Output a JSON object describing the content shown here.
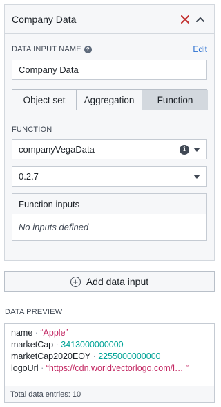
{
  "panel": {
    "title": "Company Data",
    "colors": {
      "close": "#c23030",
      "link": "#2d72d2"
    }
  },
  "data_input": {
    "label": "DATA INPUT NAME",
    "edit": "Edit",
    "value": "Company Data"
  },
  "segments": [
    {
      "label": "Object set",
      "active": false
    },
    {
      "label": "Aggregation",
      "active": false
    },
    {
      "label": "Function",
      "active": true
    }
  ],
  "function": {
    "label": "FUNCTION",
    "selected": "companyVegaData",
    "version": "0.2.7"
  },
  "function_inputs": {
    "header": "Function inputs",
    "empty": "No inputs defined"
  },
  "add_button": "Add data input",
  "preview": {
    "label": "DATA PREVIEW",
    "rows": [
      {
        "key": "name",
        "value": "“Apple”"
      },
      {
        "key": "marketCap",
        "value": "3413000000000"
      },
      {
        "key": "marketCap2020EOY",
        "value": "2255000000000"
      },
      {
        "key": "logoUrl",
        "value": "“https://cdn.worldvectorlogo.com/l… ”"
      }
    ],
    "footer_label": "Total data entries:",
    "footer_count": "10"
  }
}
